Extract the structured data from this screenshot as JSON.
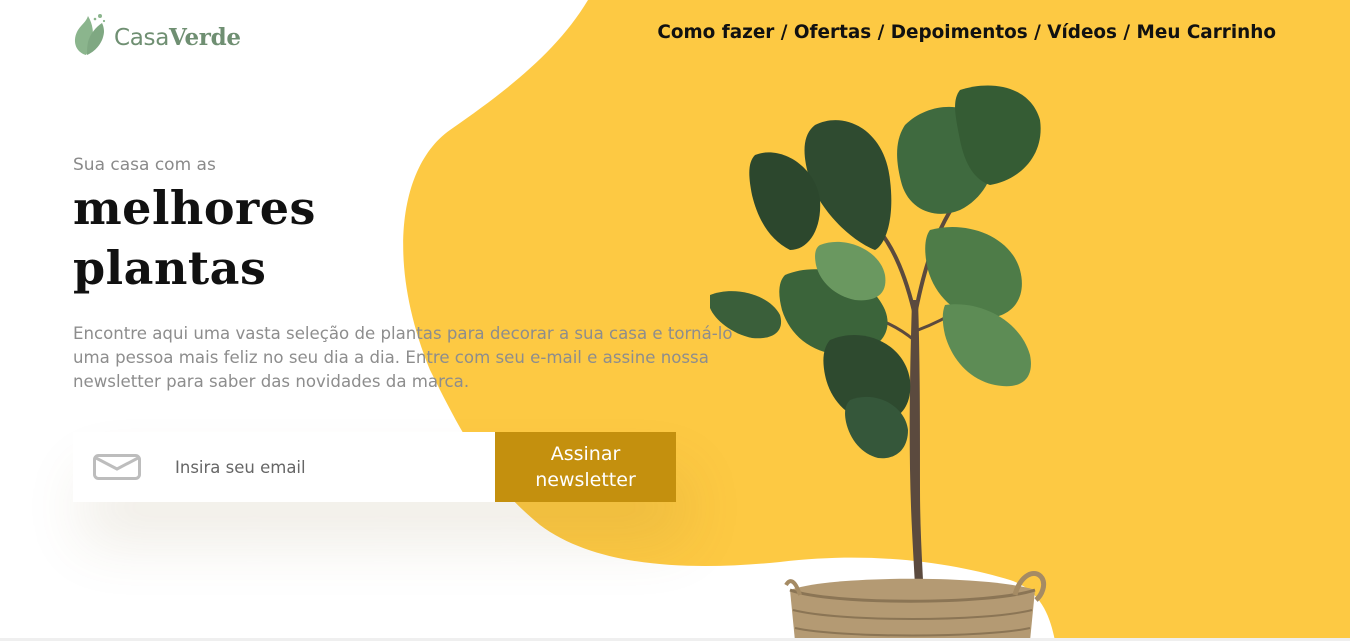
{
  "brand": {
    "name_light": "Casa",
    "name_bold": "Verde",
    "colors": {
      "leaf": "#7fa882",
      "text": "#6f8f72"
    }
  },
  "nav": {
    "items": [
      "Como fazer",
      "Ofertas",
      "Depoimentos",
      "Vídeos",
      "Meu Carrinho"
    ],
    "separator": " / "
  },
  "hero": {
    "subtitle": "Sua casa com as",
    "headline_line1": "melhores",
    "headline_line2": "plantas",
    "description": "Encontre aqui uma vasta seleção de plantas para decorar a sua casa e torná-lo uma pessoa mais feliz no seu dia a dia. Entre com seu e-mail e assine nossa newsletter para saber das novidades da marca."
  },
  "newsletter": {
    "icon": "mail-icon",
    "placeholder": "Insira seu email",
    "button_label": "Assinar newsletter"
  },
  "illustration": {
    "subject": "plant-in-wicker-basket"
  },
  "colors": {
    "accent_yellow": "#fdc943",
    "button": "#c4900e",
    "headline": "#111111",
    "muted_text": "#8d8d8d"
  }
}
